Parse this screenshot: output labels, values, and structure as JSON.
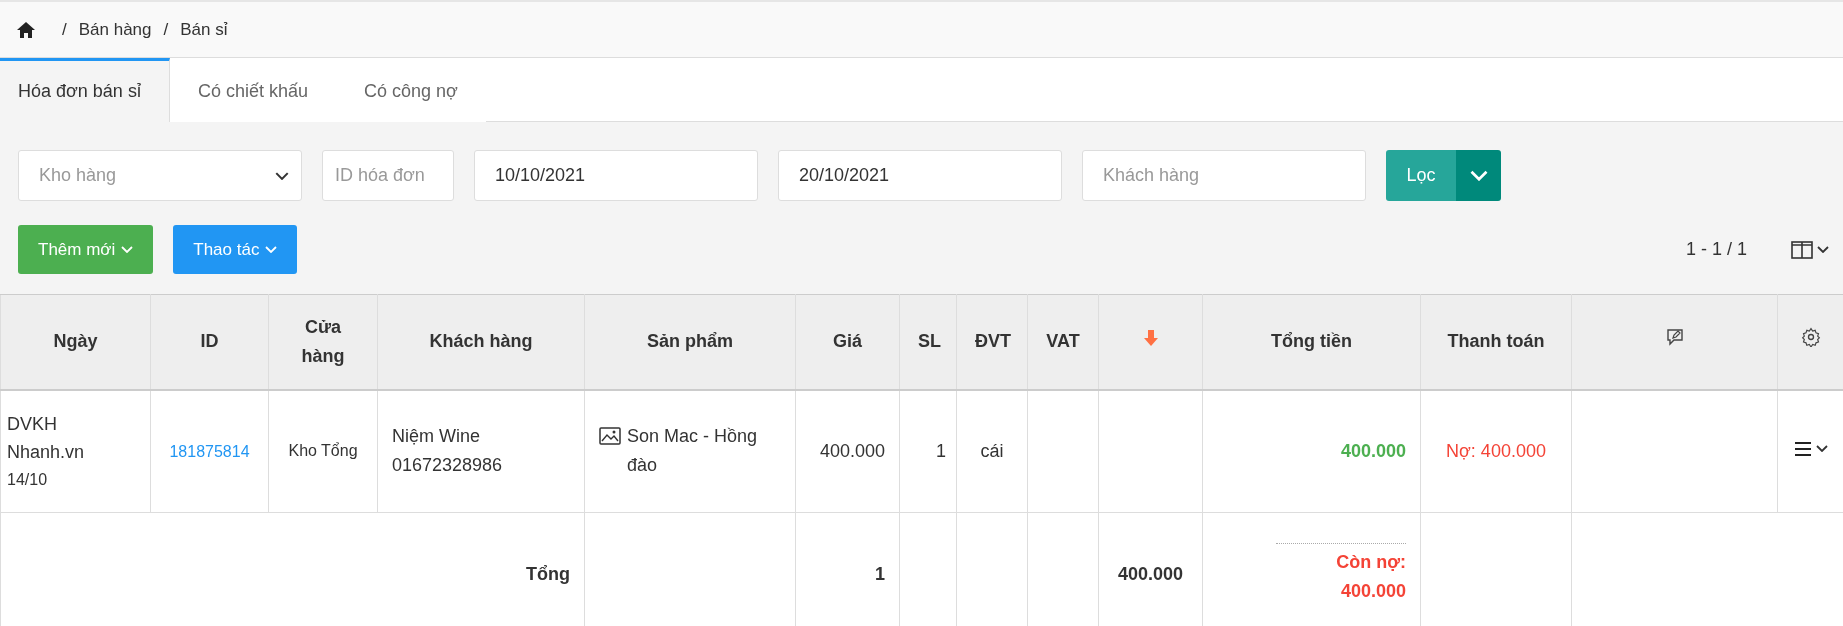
{
  "breadcrumb": [
    {
      "separator": "/",
      "label": "Bán hàng"
    },
    {
      "separator": "/",
      "label": "Bán sỉ"
    }
  ],
  "tabs": [
    {
      "label": "Hóa đơn bán sỉ",
      "selected": true
    },
    {
      "label": "Có chiết khấu",
      "selected": false
    },
    {
      "label": "Có công nợ",
      "selected": false
    }
  ],
  "filters": [
    {
      "kind": "select",
      "placeholder": "Kho hàng"
    },
    {
      "kind": "input",
      "placeholder": "ID hóa đơn"
    },
    {
      "kind": "input",
      "value": "10/10/2021"
    },
    {
      "kind": "input",
      "value": "20/10/2021"
    },
    {
      "kind": "input",
      "placeholder": "Khách hàng"
    }
  ],
  "filter_button": "Lọc",
  "actions": [
    {
      "label": "Thêm mới",
      "color": "#4caf50"
    },
    {
      "label": "Thao tác",
      "color": "#2196f3"
    }
  ],
  "pagination": "1 - 1 / 1",
  "table": {
    "columns": [
      {
        "kind": "text",
        "label": "Ngày"
      },
      {
        "kind": "text",
        "label": "ID"
      },
      {
        "kind": "text",
        "label": "Cửa hàng"
      },
      {
        "kind": "text",
        "label": "Khách hàng"
      },
      {
        "kind": "text",
        "label": "Sản phẩm"
      },
      {
        "kind": "text",
        "label": "Giá"
      },
      {
        "kind": "text",
        "label": "SL"
      },
      {
        "kind": "text",
        "label": "ĐVT"
      },
      {
        "kind": "text",
        "label": "VAT"
      },
      {
        "kind": "sort"
      },
      {
        "kind": "text",
        "label": "Tổng tiền"
      },
      {
        "kind": "text",
        "label": "Thanh toán"
      },
      {
        "kind": "note"
      },
      {
        "kind": "settings"
      }
    ],
    "rows": [
      {
        "date_lines": [
          "DVKH",
          "Nhanh.vn"
        ],
        "date": "14/10",
        "id": "181875814",
        "store": "Kho Tổng",
        "customer": "Niệm Wine",
        "phone": "01672328986",
        "product": "Son Mac - Hồng đào",
        "price": "400.000",
        "qty": "1",
        "unit": "cái",
        "total": "400.000",
        "payment": "Nợ: 400.000"
      }
    ],
    "footer": {
      "label": "Tổng",
      "qty": "1",
      "amount": "400.000",
      "debt_label": "Còn nợ:",
      "debt": "400.000"
    }
  }
}
